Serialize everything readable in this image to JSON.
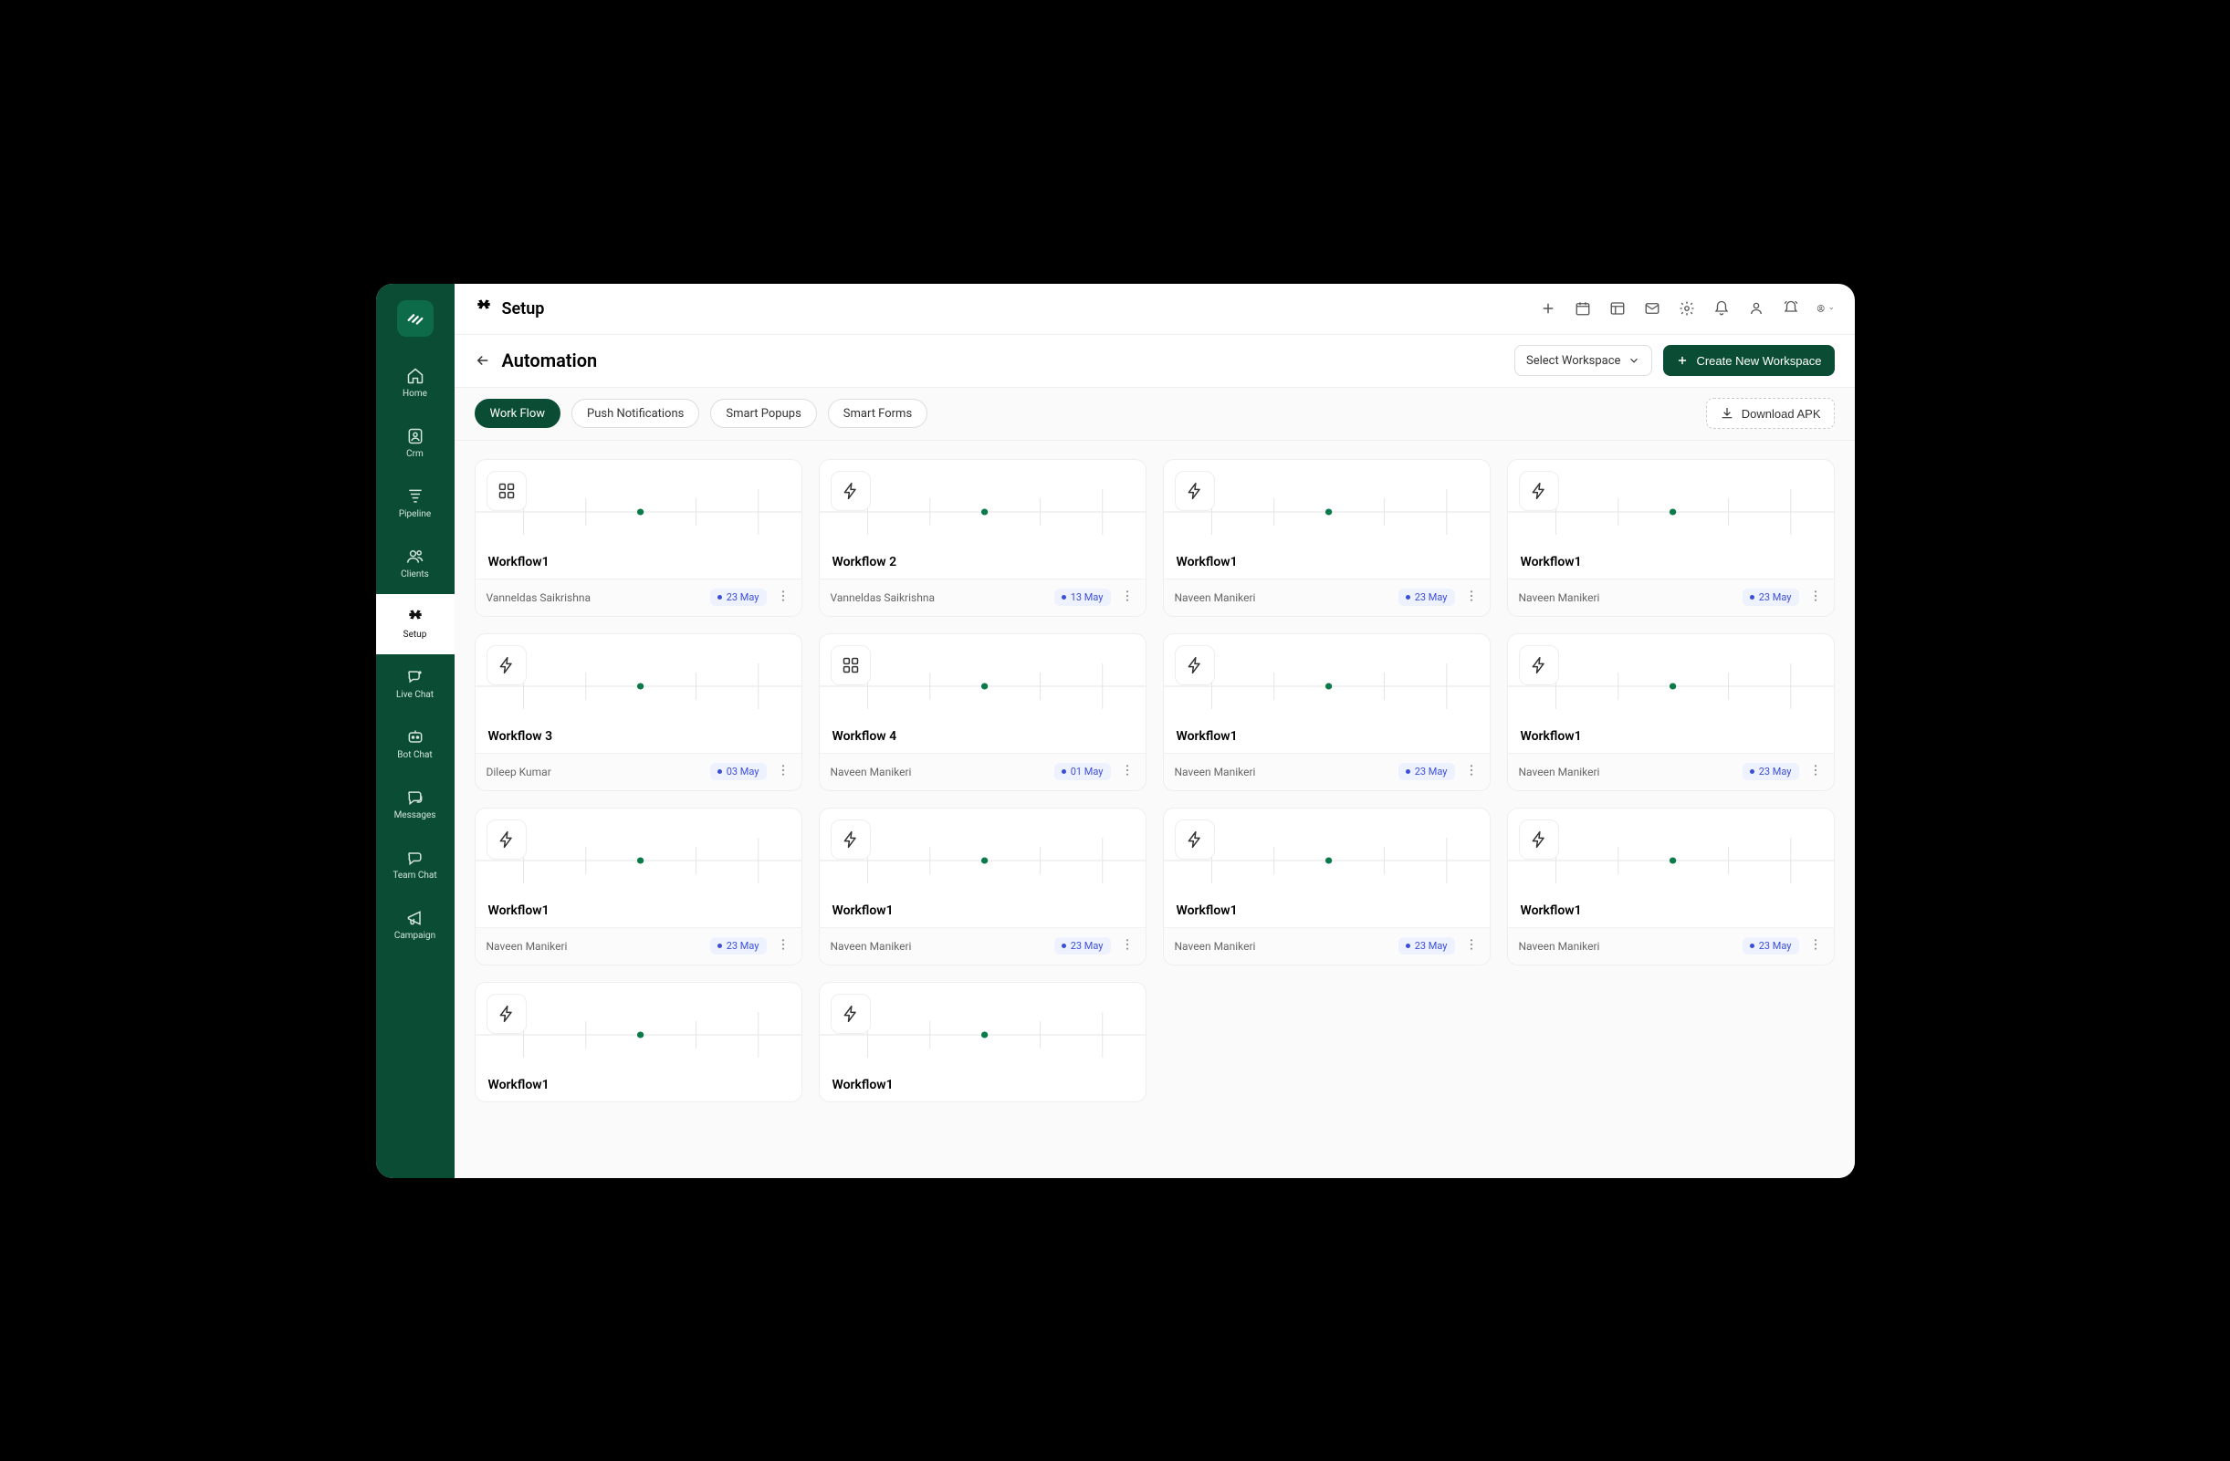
{
  "sidebar": {
    "items": [
      {
        "label": "Home"
      },
      {
        "label": "Crm"
      },
      {
        "label": "Pipeline"
      },
      {
        "label": "Clients"
      },
      {
        "label": "Setup"
      },
      {
        "label": "Live Chat"
      },
      {
        "label": "Bot Chat"
      },
      {
        "label": "Messages"
      },
      {
        "label": "Team Chat"
      },
      {
        "label": "Campaign"
      }
    ]
  },
  "topbar": {
    "title": "Setup"
  },
  "subheader": {
    "title": "Automation",
    "select_workspace": "Select Workspace",
    "create_workspace": "Create New Workspace"
  },
  "tabs": [
    {
      "label": "Work Flow",
      "active": true
    },
    {
      "label": "Push Notifications",
      "active": false
    },
    {
      "label": "Smart Popups",
      "active": false
    },
    {
      "label": "Smart Forms",
      "active": false
    }
  ],
  "download_label": "Download APK",
  "workflows": [
    {
      "title": "Workflow1",
      "author": "Vanneldas Saikrishna",
      "date": "23 May",
      "icon": "grid"
    },
    {
      "title": "Workflow 2",
      "author": "Vanneldas Saikrishna",
      "date": "13 May",
      "icon": "bolt"
    },
    {
      "title": "Workflow1",
      "author": "Naveen Manikeri",
      "date": "23 May",
      "icon": "bolt"
    },
    {
      "title": "Workflow1",
      "author": "Naveen Manikeri",
      "date": "23 May",
      "icon": "bolt"
    },
    {
      "title": "Workflow 3",
      "author": "Dileep Kumar",
      "date": "03 May",
      "icon": "bolt"
    },
    {
      "title": "Workflow 4",
      "author": "Naveen Manikeri",
      "date": "01 May",
      "icon": "grid"
    },
    {
      "title": "Workflow1",
      "author": "Naveen Manikeri",
      "date": "23 May",
      "icon": "bolt"
    },
    {
      "title": "Workflow1",
      "author": "Naveen Manikeri",
      "date": "23 May",
      "icon": "bolt"
    },
    {
      "title": "Workflow1",
      "author": "Naveen Manikeri",
      "date": "23 May",
      "icon": "bolt"
    },
    {
      "title": "Workflow1",
      "author": "Naveen Manikeri",
      "date": "23 May",
      "icon": "bolt"
    },
    {
      "title": "Workflow1",
      "author": "Naveen Manikeri",
      "date": "23 May",
      "icon": "bolt"
    },
    {
      "title": "Workflow1",
      "author": "Naveen Manikeri",
      "date": "23 May",
      "icon": "bolt"
    },
    {
      "title": "Workflow1",
      "author": "",
      "date": "",
      "icon": "bolt"
    },
    {
      "title": "Workflow1",
      "author": "",
      "date": "",
      "icon": "bolt"
    }
  ]
}
